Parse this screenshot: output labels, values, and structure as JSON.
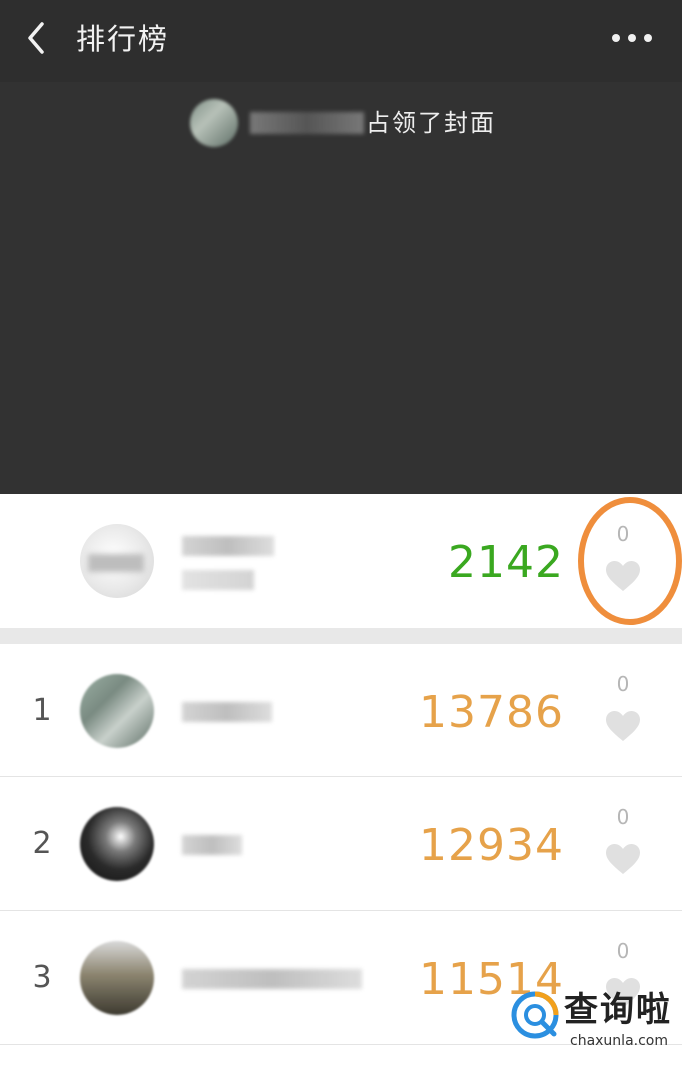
{
  "navbar": {
    "title": "排行榜"
  },
  "cover": {
    "caption": "占领了封面"
  },
  "my_entry": {
    "steps": "2142",
    "likes": "0"
  },
  "ranking": [
    {
      "rank": "1",
      "steps": "13786",
      "likes": "0"
    },
    {
      "rank": "2",
      "steps": "12934",
      "likes": "0"
    },
    {
      "rank": "3",
      "steps": "11514",
      "likes": "0"
    }
  ],
  "watermark": {
    "text": "查询啦",
    "url": "chaxunla.com"
  },
  "colors": {
    "my_steps": "#3aa820",
    "rank_steps": "#e6a24a",
    "highlight": "#ef8e3c",
    "heart": "#e0e0e0"
  },
  "icons": [
    "back-arrow-icon",
    "more-dots-icon",
    "heart-icon"
  ]
}
